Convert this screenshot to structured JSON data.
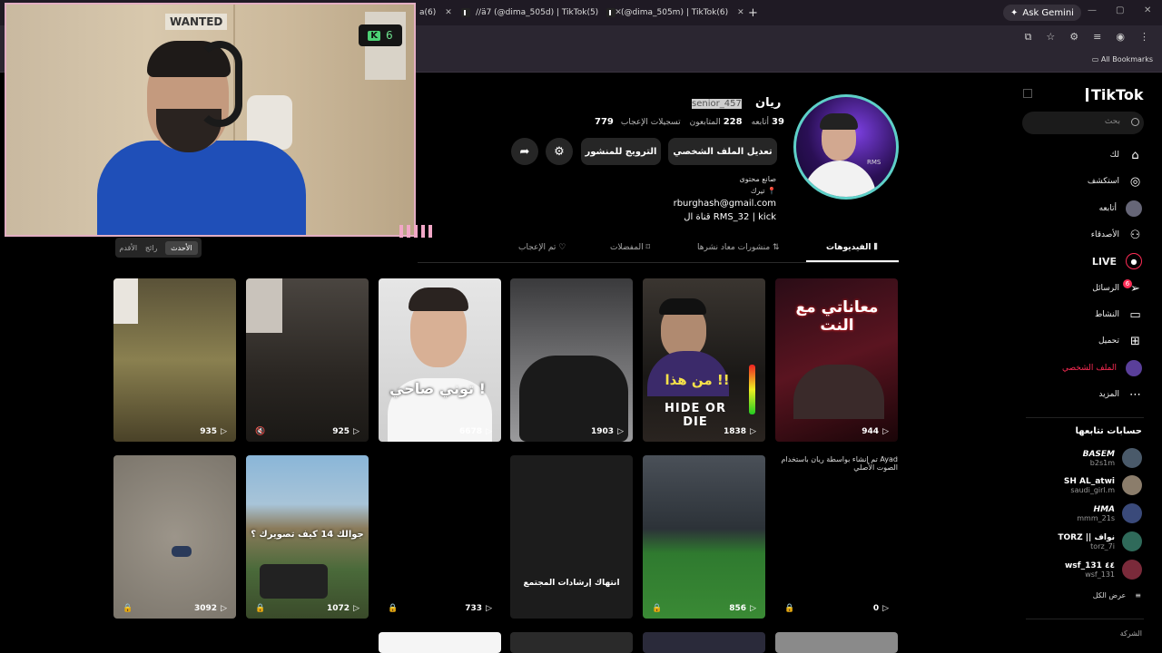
{
  "browser": {
    "tabs": [
      {
        "label": "a(6)",
        "x": 0
      },
      {
        "label": "//ä7 (@dima_505d) | TikTok(5)"
      },
      {
        "label": "(@dima_505m) | TikTok(6)"
      }
    ],
    "new_tab": "+",
    "ask_gemini": "Ask Gemini",
    "all_bookmarks": "All Bookmarks"
  },
  "stream_overlay": {
    "wanted_sign": "WANTED",
    "counter_value": "6"
  },
  "sidebar": {
    "logo": "TikTok",
    "search_placeholder": "بحث",
    "nav": [
      {
        "label": "لك",
        "icon": "home-icon"
      },
      {
        "label": "استكشف",
        "icon": "compass-icon"
      },
      {
        "label": "أتابعه",
        "icon": "following-avatar-icon"
      },
      {
        "label": "الأصدقاء",
        "icon": "friends-icon"
      },
      {
        "label": "LIVE",
        "icon": "live-icon"
      },
      {
        "label": "الرسائل",
        "icon": "messages-icon",
        "badge": "6"
      },
      {
        "label": "النشاط",
        "icon": "activity-icon"
      },
      {
        "label": "تحميل",
        "icon": "upload-icon"
      },
      {
        "label": "الملف الشخصي",
        "icon": "profile-avatar-icon"
      },
      {
        "label": "المزيد",
        "icon": "more-icon"
      }
    ],
    "following_title": "حسابات تتابعها",
    "following": [
      {
        "name": "𝘽𝘼𝙎𝙀𝙈",
        "handle": "b2s1m"
      },
      {
        "name": "SH AL_atwi",
        "handle": "saudi_girl.m"
      },
      {
        "name": "𝙃𝙈𝘼",
        "handle": "mmm_21s"
      },
      {
        "name": "TORZ || نواف",
        "handle": "torz_7i"
      },
      {
        "name": "wsf_131 ٤٤",
        "handle": "wsf_131"
      }
    ],
    "see_all": "عرض الكل",
    "company": "الشركة"
  },
  "profile": {
    "name": "ريان",
    "username": "senior_457",
    "stats": {
      "following_count": "39",
      "following_label": "أتابعه",
      "followers_count": "228",
      "followers_label": "المتابعون",
      "likes_count": "779",
      "likes_label": "تسجيلات الإعجاب"
    },
    "buttons": {
      "edit": "تعديل الملف الشخصي",
      "promote": "الترويج للمنشور"
    },
    "bio": [
      "صانع محتوى",
      "تيرك 📍",
      "rburghash@gmail.com",
      "قناة ال RMS_32 | kick"
    ]
  },
  "tabs": {
    "videos": "الفيديوهات",
    "reposts": "منشورات معاد نشرها",
    "favorites": "المفضلات",
    "liked": "تم الإعجاب"
  },
  "sort": {
    "latest": "الأحدث",
    "popular": "رائج",
    "oldest": "الأقدم"
  },
  "videos": [
    {
      "views": "944",
      "overlay": "معاناتي مع النت"
    },
    {
      "views": "1838",
      "overlay": "من هذا !!",
      "overlay2": "HIDE OR DIE"
    },
    {
      "views": "1903",
      "overlay": ""
    },
    {
      "views": "6678",
      "overlay": "توني صاحي !"
    },
    {
      "views": "925",
      "overlay": ""
    },
    {
      "views": "935",
      "overlay": ""
    },
    {
      "views": "0",
      "overlay": "",
      "notice": "تم إنشاء بواسطة ريان باستخدام Ayad الصوت الأصلي"
    },
    {
      "views": "856",
      "overlay": ""
    },
    {
      "views": "",
      "overlay": "انتهاك إرشادات المجتمع"
    },
    {
      "views": "733",
      "overlay": ""
    },
    {
      "views": "1072",
      "overlay": "جوالك 14 كيف تصويرك ؟"
    },
    {
      "views": "3092",
      "overlay": ""
    }
  ],
  "colors": {
    "accent": "#fe2c55",
    "avatar_ring": "#5ed0c8"
  }
}
